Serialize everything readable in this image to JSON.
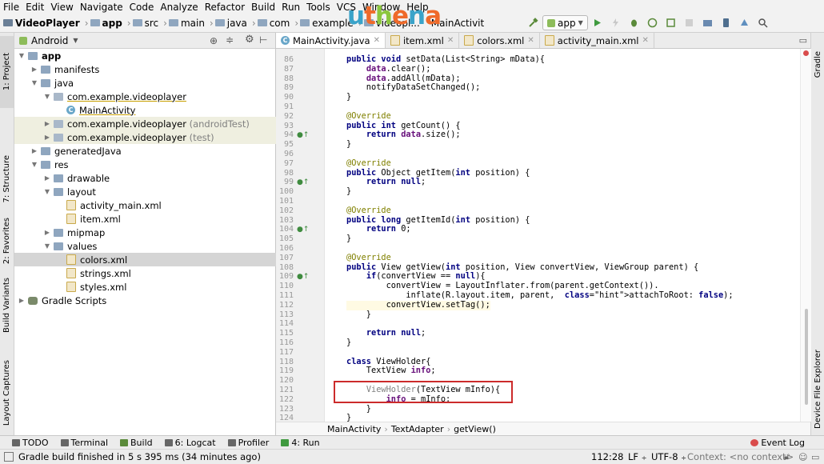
{
  "menu": [
    "File",
    "Edit",
    "View",
    "Navigate",
    "Code",
    "Analyze",
    "Refactor",
    "Build",
    "Run",
    "Tools",
    "VCS",
    "Window",
    "Help"
  ],
  "logo_text": "uthena",
  "nav": {
    "crumbs": [
      "VideoPlayer",
      "app",
      "src",
      "main",
      "java",
      "com",
      "example",
      "videopl..."
    ],
    "partial_tab": "MainActivit",
    "run_config": "app"
  },
  "left_tabs": [
    "1: Project",
    "7: Structure",
    "2: Favorites",
    "Build Variants",
    "Layout Captures"
  ],
  "right_tabs": [
    "Gradle",
    "Device File Explorer"
  ],
  "project": {
    "view_selector": "Android",
    "tree": [
      {
        "label": "app",
        "bold": true
      },
      {
        "label": "manifests"
      },
      {
        "label": "java"
      },
      {
        "label": "com.example.videoplayer",
        "underline": true
      },
      {
        "label": "MainActivity"
      },
      {
        "label": "com.example.videoplayer",
        "suffix": "(androidTest)"
      },
      {
        "label": "com.example.videoplayer",
        "suffix": "(test)"
      },
      {
        "label": "generatedJava"
      },
      {
        "label": "res"
      },
      {
        "label": "drawable"
      },
      {
        "label": "layout"
      },
      {
        "label": "activity_main.xml"
      },
      {
        "label": "item.xml"
      },
      {
        "label": "mipmap"
      },
      {
        "label": "values"
      },
      {
        "label": "colors.xml"
      },
      {
        "label": "strings.xml"
      },
      {
        "label": "styles.xml"
      },
      {
        "label": "Gradle Scripts"
      }
    ]
  },
  "editor": {
    "tabs": [
      "MainActivity.java",
      "item.xml",
      "colors.xml",
      "activity_main.xml"
    ],
    "line_numbers": [
      "86",
      "87",
      "88",
      "89",
      "90",
      "91",
      "92",
      "93",
      "94",
      "95",
      "96",
      "97",
      "98",
      "99",
      "100",
      "101",
      "102",
      "103",
      "104",
      "105",
      "106",
      "107",
      "108",
      "109",
      "110",
      "111",
      "112",
      "113",
      "114",
      "115",
      "116",
      "117",
      "118",
      "119",
      "120",
      "121",
      "122",
      "123",
      "124"
    ],
    "lines": [
      "public void setData(List<String> mData){",
      "    data.clear();",
      "    data.addAll(mData);",
      "    notifyDataSetChanged();",
      "}",
      "",
      "@Override",
      "public int getCount() {",
      "    return data.size();",
      "}",
      "",
      "@Override",
      "public Object getItem(int position) {",
      "    return null;",
      "}",
      "",
      "@Override",
      "public long getItemId(int position) {",
      "    return 0;",
      "}",
      "",
      "@Override",
      "public View getView(int position, View convertView, ViewGroup parent) {",
      "    if(convertView == null){",
      "        convertView = LayoutInflater.from(parent.getContext()).",
      "            inflate(R.layout.item, parent,  attachToRoot: false);",
      "        convertView.setTag();",
      "    }",
      "",
      "    return null;",
      "}",
      "",
      "class ViewHolder{",
      "    TextView info;",
      "",
      "    ViewHolder(TextView mInfo){",
      "        info = mInfo;",
      "    }",
      "}"
    ],
    "breadcrumb": [
      "MainActivity",
      "TextAdapter",
      "getView()"
    ]
  },
  "bottom_tools": [
    "TODO",
    "Terminal",
    "Build",
    "6: Logcat",
    "Profiler",
    "4: Run"
  ],
  "event_log": "Event Log",
  "status": {
    "message": "Gradle build finished in 5 s 395 ms (34 minutes ago)",
    "position": "112:28",
    "line_sep": "LF",
    "encoding": "UTF-8",
    "context": "Context: <no context>"
  },
  "colors": {
    "keyword": "#000080",
    "field": "#660e7a",
    "annotation": "#808000",
    "highlight_box": "#cc2b2b"
  }
}
